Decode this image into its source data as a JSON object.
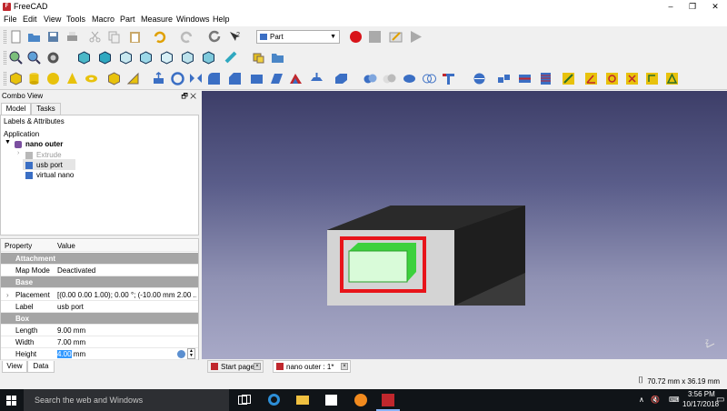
{
  "window": {
    "title": "FreeCAD",
    "minimize": "–",
    "maximize": "❐",
    "close": "✕"
  },
  "menu": [
    "File",
    "Edit",
    "View",
    "Tools",
    "Macro",
    "Part",
    "Measure",
    "Windows",
    "Help"
  ],
  "workbench_selector": {
    "value": "Part"
  },
  "combo_view": {
    "title": "Combo View",
    "controls": "🗗 ✕",
    "tabs": [
      "Model",
      "Tasks"
    ],
    "tree": {
      "header": "Labels & Attributes",
      "root": "Application",
      "document": "nano outer",
      "items": [
        "Extrude",
        "usb port",
        "virtual nano"
      ]
    }
  },
  "property_editor": {
    "columns": [
      "Property",
      "Value"
    ],
    "rows": [
      {
        "group": "Attachment"
      },
      {
        "name": "Map Mode",
        "value": "Deactivated"
      },
      {
        "group": "Base"
      },
      {
        "name": "Placement",
        "value": "[(0.00 0.00 1.00); 0.00 °; (-10.00 mm  2.00 ..."
      },
      {
        "name": "Label",
        "value": "usb port"
      },
      {
        "group": "Box"
      },
      {
        "name": "Length",
        "value": "9.00 mm"
      },
      {
        "name": "Width",
        "value": "7.00 mm"
      },
      {
        "name": "Height",
        "value_selected": "4.00",
        "unit": " mm"
      }
    ],
    "bottom_tabs": [
      "View",
      "Data"
    ]
  },
  "document_tabs": [
    {
      "label": "Start page",
      "active": false
    },
    {
      "label": "nano outer : 1*",
      "active": true
    }
  ],
  "status": {
    "dimensions": "70.72 mm x 36.19 mm"
  },
  "taskbar": {
    "search_placeholder": "Search the web and Windows",
    "time": "3:56 PM",
    "date": "10/17/2018"
  },
  "colors": {
    "accent": "#3b6fc4",
    "highlight_red": "#e8141a",
    "box_green": "#3dd13d",
    "freecad_red": "#c0272d"
  }
}
